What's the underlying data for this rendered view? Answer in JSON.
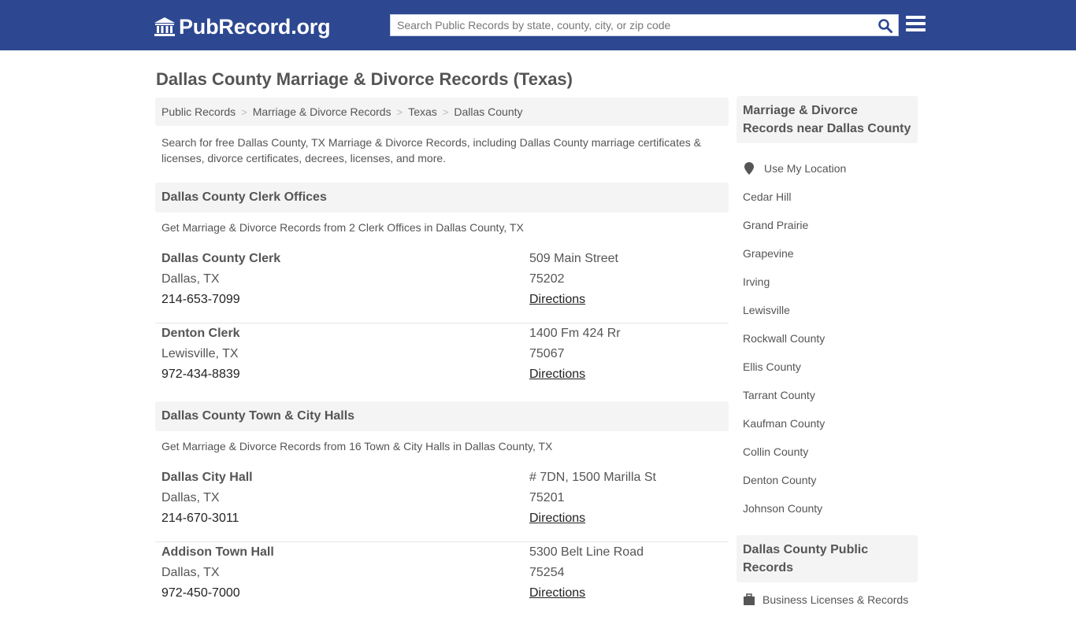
{
  "header": {
    "logo_text": "PubRecord.org",
    "search_placeholder": "Search Public Records by state, county, city, or zip code",
    "search_value": "",
    "colors": {
      "brand": "#2d4891",
      "search_icon": "#2d4891"
    }
  },
  "page": {
    "title": "Dallas County Marriage & Divorce Records (Texas)",
    "breadcrumb": [
      "Public Records",
      "Marriage & Divorce Records",
      "Texas",
      "Dallas County"
    ],
    "intro": "Search for free Dallas County, TX Marriage & Divorce Records, including Dallas County marriage certificates & licenses, divorce certificates, decrees, licenses, and more."
  },
  "sections": [
    {
      "title": "Dallas County Clerk Offices",
      "subtitle": "Get Marriage & Divorce Records from 2 Clerk Offices in Dallas County, TX",
      "offices": [
        {
          "name": "Dallas County Clerk",
          "city": "Dallas, TX",
          "phone": "214-653-7099",
          "address": "509 Main Street",
          "zip": "75202",
          "directions_label": "Directions"
        },
        {
          "name": "Denton Clerk",
          "city": "Lewisville, TX",
          "phone": "972-434-8839",
          "address": "1400 Fm 424 Rr",
          "zip": "75067",
          "directions_label": "Directions"
        }
      ]
    },
    {
      "title": "Dallas County Town & City Halls",
      "subtitle": "Get Marriage & Divorce Records from 16 Town & City Halls in Dallas County, TX",
      "offices": [
        {
          "name": "Dallas City Hall",
          "city": "Dallas, TX",
          "phone": "214-670-3011",
          "address": "# 7DN, 1500 Marilla St",
          "zip": "75201",
          "directions_label": "Directions"
        },
        {
          "name": "Addison Town Hall",
          "city": "Dallas, TX",
          "phone": "972-450-7000",
          "address": "5300 Belt Line Road",
          "zip": "75254",
          "directions_label": "Directions"
        }
      ]
    }
  ],
  "sidebar": {
    "nearby_title": "Marriage & Divorce Records near Dallas County",
    "use_location_label": "Use My Location",
    "nearby": [
      "Cedar Hill",
      "Grand Prairie",
      "Grapevine",
      "Irving",
      "Lewisville",
      "Rockwall County",
      "Ellis County",
      "Tarrant County",
      "Kaufman County",
      "Collin County",
      "Denton County",
      "Johnson County"
    ],
    "public_records_title": "Dallas County Public Records",
    "public_records_items": [
      "Business Licenses & Records"
    ]
  }
}
